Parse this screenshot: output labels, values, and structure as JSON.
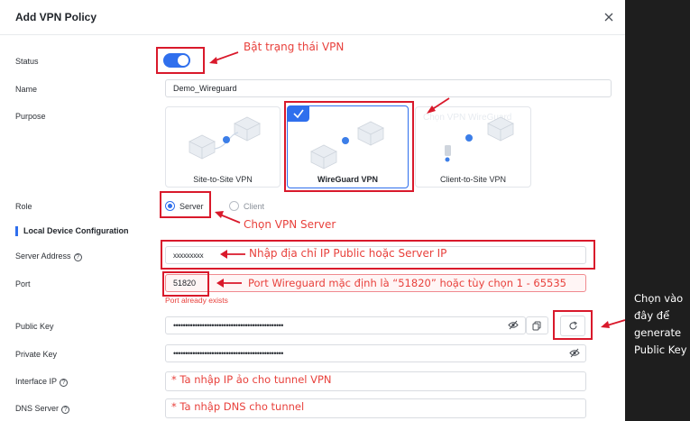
{
  "dialog": {
    "title": "Add VPN Policy"
  },
  "form": {
    "status_label": "Status",
    "name_label": "Name",
    "name_value": "Demo_Wireguard",
    "purpose_label": "Purpose",
    "purpose_options": [
      "Site-to-Site VPN",
      "WireGuard VPN",
      "Client-to-Site VPN"
    ],
    "purpose_selected": "WireGuard VPN",
    "watermark": "Chọn VPN WireGuard",
    "role_label": "Role",
    "role_server": "Server",
    "role_client": "Client",
    "section_title": "Local Device Configuration",
    "server_address_label": "Server Address",
    "server_address_value": "xxxxxxxxx",
    "port_label": "Port",
    "port_value": "51820",
    "port_error": "Port already exists",
    "public_key_label": "Public Key",
    "public_key_value": "••••••••••••••••••••••••••••••••••••••••••••••",
    "private_key_label": "Private Key",
    "private_key_value": "••••••••••••••••••••••••••••••••••••••••••••••",
    "interface_ip_label": "Interface IP",
    "dns_server_label": "DNS Server"
  },
  "annotations": {
    "status": "Bật trạng thái VPN",
    "role": "Chọn VPN Server",
    "server_address": "Nhập địa chỉ IP Public hoặc Server IP",
    "port": "Port Wireguard mặc định là “51820” hoặc tùy chọn 1 - 65535",
    "interface_ip": "* Ta nhập IP ảo cho tunnel VPN",
    "dns_server": "* Ta nhập DNS cho tunnel",
    "public_key_lines": [
      "Chọn vào",
      "đây để",
      "generate",
      "Public Key"
    ]
  },
  "colors": {
    "accent": "#2f6fed",
    "annotation_red": "#d9192b"
  }
}
